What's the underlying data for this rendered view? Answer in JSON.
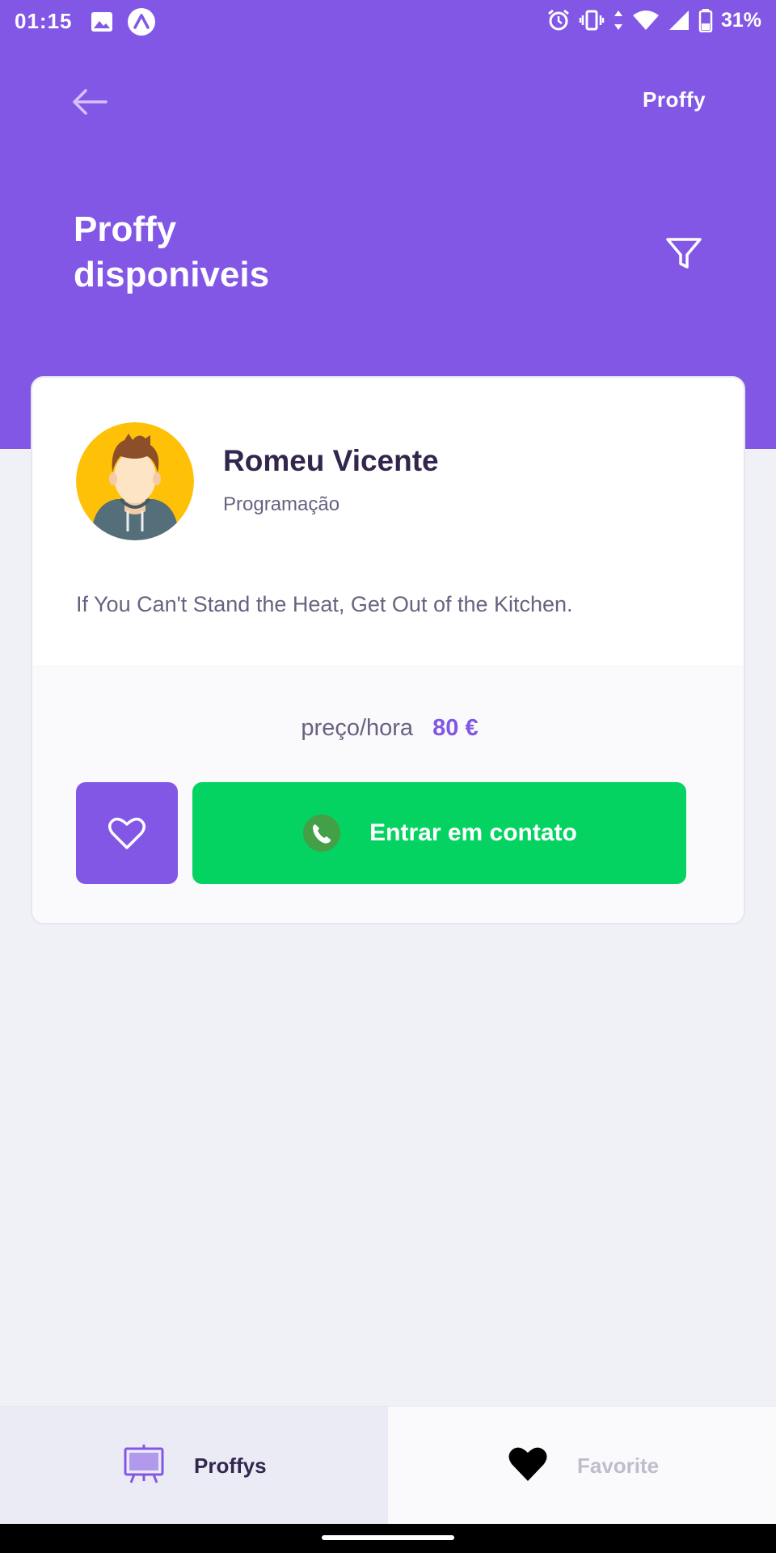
{
  "status_bar": {
    "time": "01:15",
    "battery": "31%",
    "icons": [
      "gallery-icon",
      "expo-icon",
      "alarm-icon",
      "vibrate-icon",
      "data-arrows-icon",
      "wifi-icon",
      "signal-icon",
      "battery-icon"
    ]
  },
  "header": {
    "logo": "Proffy",
    "title_line1": "Proffy",
    "title_line2": "disponiveis",
    "back_icon": "arrow-left-icon",
    "filter_icon": "filter-icon"
  },
  "teacher": {
    "name": "Romeu Vicente",
    "subject": "Programação",
    "bio": "If You Can't Stand the Heat, Get Out of the Kitchen.",
    "price_label": "preço/hora",
    "price_value": "80 €",
    "contact_label": "Entrar em contato"
  },
  "tabs": [
    {
      "label": "Proffys",
      "icon": "easel-icon",
      "active": true
    },
    {
      "label": "Favorite",
      "icon": "heart-filled-icon",
      "active": false
    }
  ],
  "colors": {
    "primary": "#8257E5",
    "secondary": "#04D361",
    "background": "#F0F0F7",
    "title_text": "#32264D",
    "body_text": "#6A6180"
  }
}
